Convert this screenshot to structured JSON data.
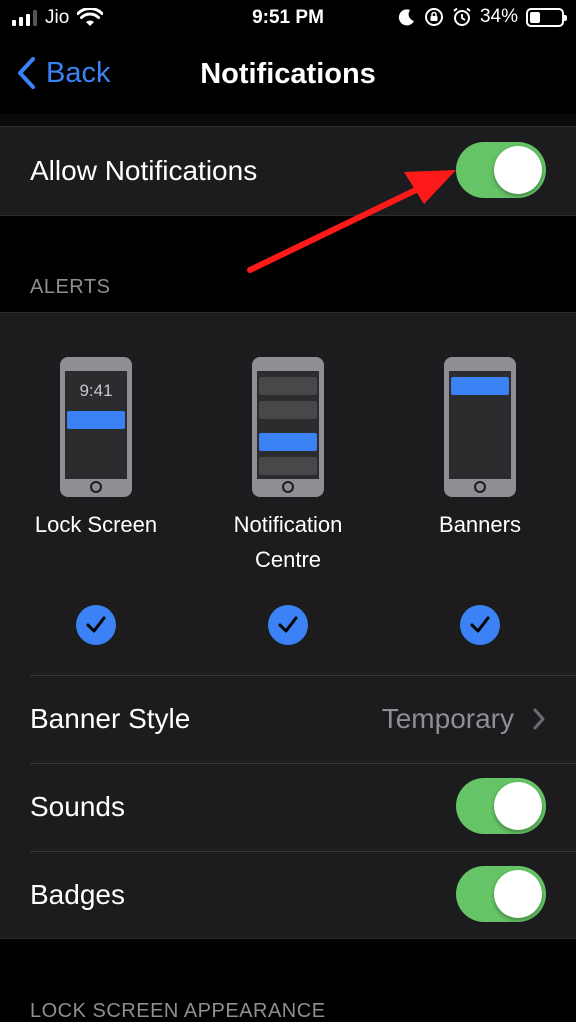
{
  "status_bar": {
    "carrier": "Jio",
    "time": "9:51 PM",
    "battery": "34%",
    "battery_level": 0.34
  },
  "nav": {
    "back_label": "Back",
    "title": "Notifications"
  },
  "allow": {
    "label": "Allow Notifications",
    "enabled": true
  },
  "alerts": {
    "header": "ALERTS",
    "lock_screen_time": "9:41",
    "items": [
      {
        "label": "Lock Screen",
        "checked": true
      },
      {
        "label": "Notification\nCentre",
        "label_line1": "Notification",
        "label_line2": "Centre",
        "checked": true
      },
      {
        "label": "Banners",
        "checked": true
      }
    ]
  },
  "settings": {
    "banner_style_label": "Banner Style",
    "banner_style_value": "Temporary",
    "sounds_label": "Sounds",
    "sounds_enabled": true,
    "badges_label": "Badges",
    "badges_enabled": true
  },
  "lock_screen_appearance": {
    "header": "LOCK SCREEN APPEARANCE"
  },
  "colors": {
    "accent": "#3b82f6",
    "toggle_on": "#65c466",
    "annotation_arrow": "#ff1a1a"
  }
}
